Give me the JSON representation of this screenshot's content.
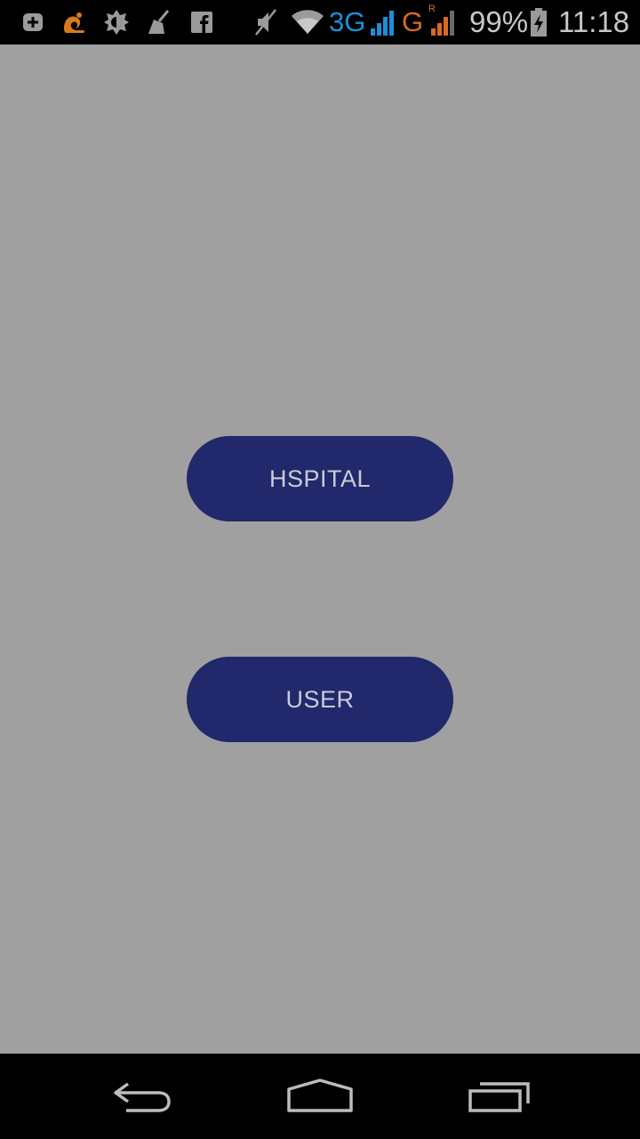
{
  "status_bar": {
    "left_icons": [
      "add-notification-icon",
      "uc-browser-icon",
      "brightness-icon",
      "cleaner-icon",
      "facebook-icon"
    ],
    "right_icons": [
      "mute-icon",
      "wifi-icon",
      "signal-icon",
      "roaming-signal-icon",
      "battery-charging-icon"
    ],
    "network_3g": "3G",
    "network_g": "G",
    "roaming_marker": "R",
    "battery": "99%",
    "time": "11:18",
    "colors": {
      "network_3g": "#1c8fd6",
      "network_g": "#d86a1e",
      "uc_browser": "#d97a1a"
    }
  },
  "main": {
    "background": "#a0a0a0",
    "buttons": [
      {
        "label": "HSPITAL",
        "color": "#21286b"
      },
      {
        "label": "USER",
        "color": "#21286b"
      }
    ]
  },
  "nav_bar": {
    "buttons": [
      "back-icon",
      "home-icon",
      "recent-apps-icon"
    ]
  }
}
